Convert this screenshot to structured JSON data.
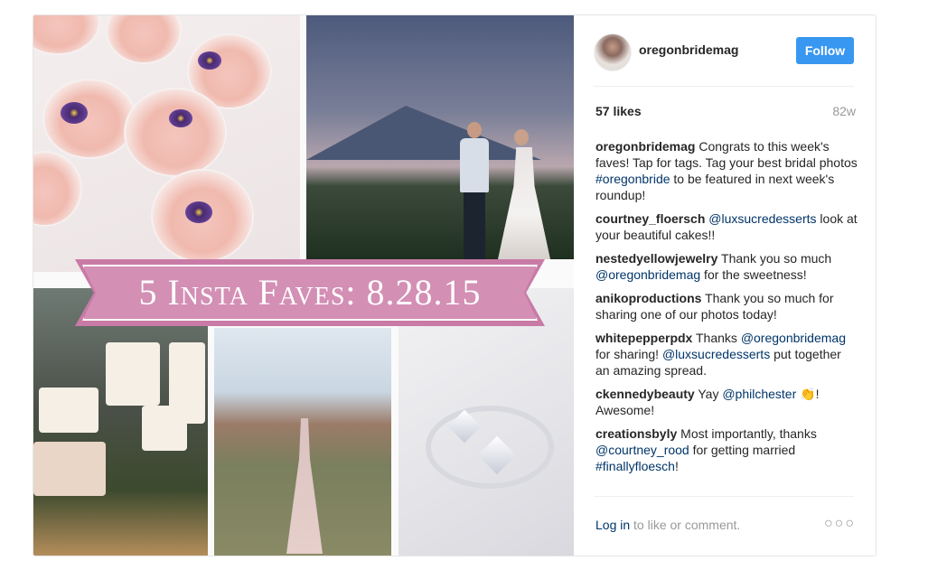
{
  "post": {
    "banner_text": "5 Insta Faves: 8.28.15"
  },
  "header": {
    "username": "oregonbridemag",
    "follow_label": "Follow"
  },
  "stats": {
    "likes": "57 likes",
    "age": "82w"
  },
  "comments": [
    {
      "user": "oregonbridemag",
      "parts": [
        {
          "t": "Congrats to this week's faves! Tap for tags. Tag your best bridal photos "
        },
        {
          "l": "#oregonbride"
        },
        {
          "t": " to be featured in next week's roundup!"
        }
      ]
    },
    {
      "user": "courtney_floersch",
      "parts": [
        {
          "l": "@luxsucredesserts"
        },
        {
          "t": " look at your beautiful cakes!!"
        }
      ]
    },
    {
      "user": "nestedyellowjewelry",
      "parts": [
        {
          "t": "Thank you so much "
        },
        {
          "l": "@oregonbridemag"
        },
        {
          "t": " for the sweetness!"
        }
      ]
    },
    {
      "user": "anikoproductions",
      "parts": [
        {
          "t": "Thank you so much for sharing one of our photos today!"
        }
      ]
    },
    {
      "user": "whitepepperpdx",
      "parts": [
        {
          "t": "Thanks "
        },
        {
          "l": "@oregonbridemag"
        },
        {
          "t": " for sharing! "
        },
        {
          "l": "@luxsucredesserts"
        },
        {
          "t": " put together an amazing spread."
        }
      ]
    },
    {
      "user": "ckennedybeauty",
      "parts": [
        {
          "t": "Yay "
        },
        {
          "l": "@philchester"
        },
        {
          "t": " 👏! Awesome!"
        }
      ]
    },
    {
      "user": "creationsbyly",
      "parts": [
        {
          "t": "Most importantly, thanks "
        },
        {
          "l": "@courtney_rood"
        },
        {
          "t": " for getting married "
        },
        {
          "l": "#finallyfloesch"
        },
        {
          "t": "!"
        }
      ]
    }
  ],
  "footer": {
    "login_label": "Log in",
    "login_suffix": " to like or comment.",
    "more_label": "○○○"
  },
  "colors": {
    "follow": "#3897f0",
    "link": "#003569",
    "banner": "#d38fb4"
  }
}
